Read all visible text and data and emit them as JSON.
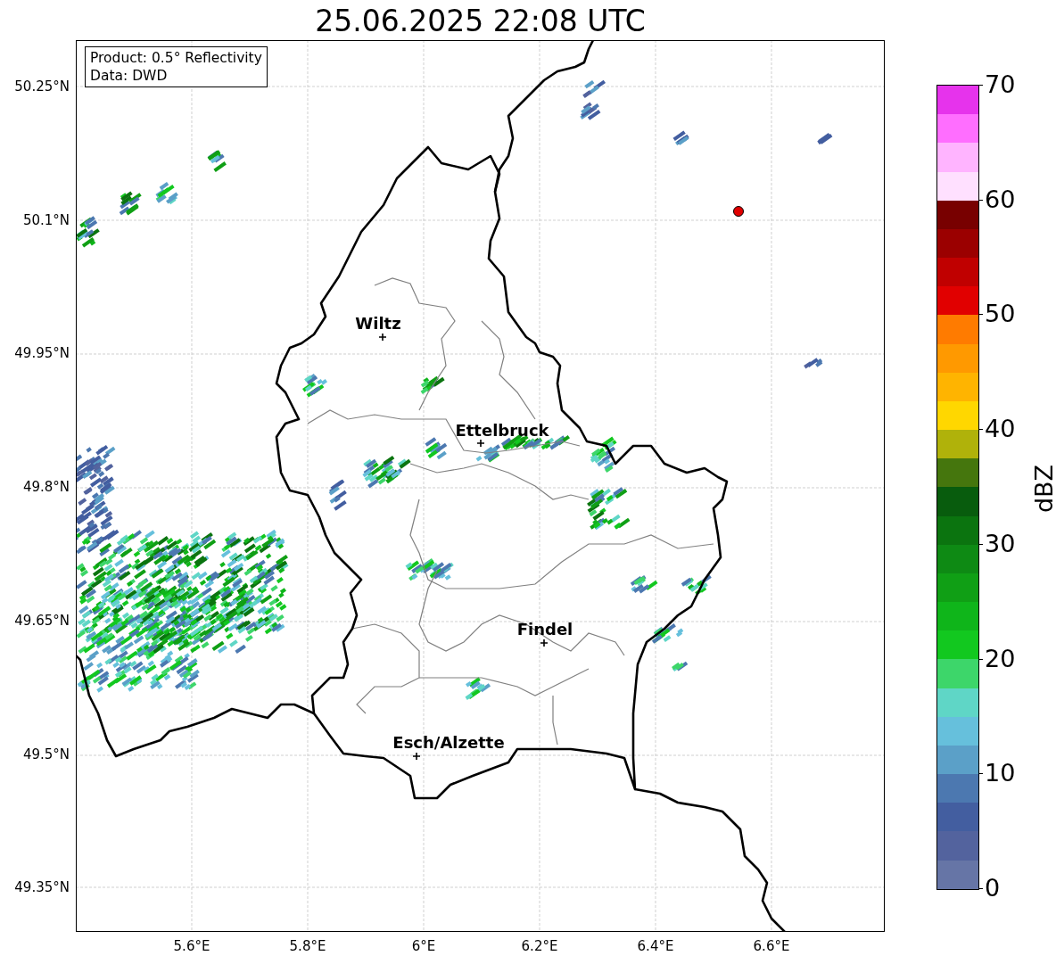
{
  "title": "25.06.2025 22:08 UTC",
  "info_box": [
    "Product: 0.5° Reflectivity",
    "Data: DWD"
  ],
  "map": {
    "xticks": [
      "5.6°E",
      "5.8°E",
      "6°E",
      "6.2°E",
      "6.4°E",
      "6.6°E"
    ],
    "yticks": [
      "50.25°N",
      "50.1°N",
      "49.95°N",
      "49.8°N",
      "49.65°N",
      "49.5°N",
      "49.35°N"
    ],
    "cities": [
      {
        "name": "Wiltz"
      },
      {
        "name": "Ettelbruck"
      },
      {
        "name": "Findel"
      },
      {
        "name": "Esch/Alzette"
      }
    ]
  },
  "colorbar": {
    "label": "dBZ",
    "ticks": [
      "70",
      "60",
      "50",
      "40",
      "30",
      "20",
      "10",
      "0"
    ],
    "segments": [
      {
        "color": "#6675a6"
      },
      {
        "color": "#53639e"
      },
      {
        "color": "#435ea0"
      },
      {
        "color": "#4c78b0"
      },
      {
        "color": "#5ba0c8"
      },
      {
        "color": "#66c0dc"
      },
      {
        "color": "#5fd6c6"
      },
      {
        "color": "#3dd66a"
      },
      {
        "color": "#12c81f"
      },
      {
        "color": "#0fb51a"
      },
      {
        "color": "#109f15"
      },
      {
        "color": "#0e8a14"
      },
      {
        "color": "#0b740f"
      },
      {
        "color": "#085c0d"
      },
      {
        "color": "#45760d"
      },
      {
        "color": "#b0b20a"
      },
      {
        "color": "#ffd700"
      },
      {
        "color": "#ffb400"
      },
      {
        "color": "#ff9900"
      },
      {
        "color": "#ff7b00"
      },
      {
        "color": "#e10000"
      },
      {
        "color": "#c00000"
      },
      {
        "color": "#9b0000"
      },
      {
        "color": "#780000"
      },
      {
        "color": "#ffe0ff"
      },
      {
        "color": "#ffb4ff"
      },
      {
        "color": "#ff6eff"
      },
      {
        "color": "#e633ec"
      }
    ]
  }
}
